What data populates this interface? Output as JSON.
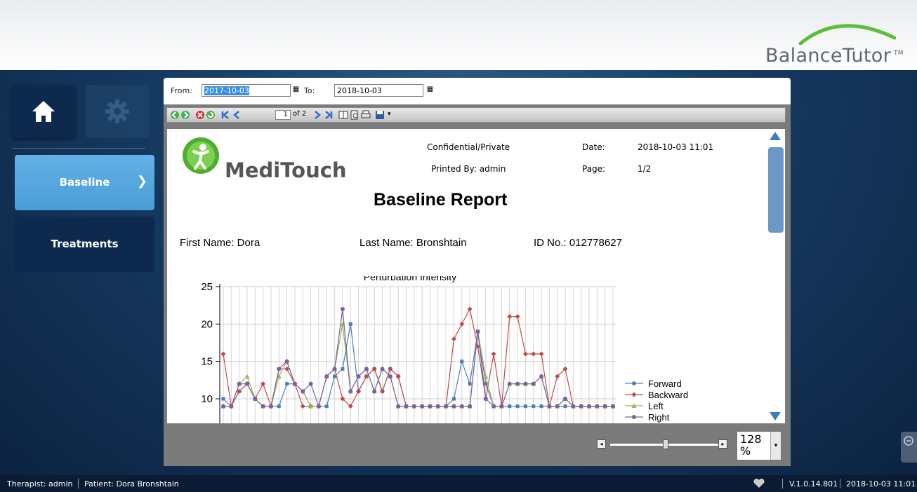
{
  "app": {
    "brand": "BalanceTutor",
    "brand_tm": "TM",
    "accent_green": "#5cbf3a",
    "accent_blue": "#4a9dd6"
  },
  "sidebar": {
    "home_icon": "home-icon",
    "settings_icon": "gear-icon",
    "items": [
      {
        "label": "Baseline",
        "active": true
      },
      {
        "label": "Treatments",
        "active": false
      }
    ]
  },
  "date_range": {
    "from_label": "From:",
    "from_value": "2017-10-03",
    "to_label": "To:",
    "to_value": "2018-10-03"
  },
  "viewer": {
    "page_current": "1",
    "page_total": "of 2",
    "zoom_value": "128",
    "zoom_unit": "%"
  },
  "report": {
    "logo_text": "MediTouch",
    "confidential": "Confidential/Private",
    "printed_by": "Printed By: admin",
    "date_label": "Date:",
    "date_value": "2018-10-03 11:01",
    "page_label": "Page:",
    "page_value": "1/2",
    "title": "Baseline Report",
    "first_name": "First Name:  Dora",
    "last_name": "Last Name:  Bronshtain",
    "id_no": "ID No.: 012778627"
  },
  "chart_data": {
    "type": "line",
    "title": "Perturbation Intensity",
    "xlabel": "",
    "ylabel": "",
    "ylim": [
      9,
      25
    ],
    "yticks": [
      10,
      15,
      20,
      25
    ],
    "grid": true,
    "legend_position": "right",
    "x": [
      1,
      2,
      3,
      4,
      5,
      6,
      7,
      8,
      9,
      10,
      11,
      12,
      13,
      14,
      15,
      16,
      17,
      18,
      19,
      20,
      21,
      22,
      23,
      24,
      25,
      26,
      27,
      28,
      29,
      30,
      31,
      32,
      33,
      34,
      35,
      36,
      37,
      38,
      39,
      40,
      41,
      42,
      43,
      44,
      45,
      46,
      47,
      48,
      49,
      50
    ],
    "series": [
      {
        "name": "Forward",
        "color": "#4a7ebb",
        "marker": "square",
        "values": [
          10,
          9,
          11,
          12,
          10,
          9,
          9,
          9,
          12,
          12,
          11,
          9,
          9,
          9,
          13,
          14,
          20,
          11,
          13,
          14,
          11,
          14,
          13,
          9,
          9,
          9,
          9,
          9,
          9,
          10,
          15,
          12,
          19,
          12,
          9,
          9,
          9,
          9,
          9,
          9,
          9,
          9,
          9,
          9,
          9,
          9,
          9,
          9,
          9,
          9
        ]
      },
      {
        "name": "Backward",
        "color": "#be4b48",
        "marker": "diamond",
        "values": [
          16,
          9,
          11,
          12,
          10,
          12,
          9,
          14,
          14,
          12,
          9,
          9,
          9,
          13,
          14,
          10,
          9,
          11,
          13,
          14,
          11,
          14,
          13,
          9,
          9,
          9,
          9,
          9,
          9,
          18,
          20,
          22,
          17,
          10,
          16,
          9,
          21,
          21,
          16,
          16,
          16,
          9,
          13,
          14,
          9,
          9,
          9,
          9,
          9,
          9
        ]
      },
      {
        "name": "Left",
        "color": "#98b954",
        "marker": "triangle",
        "values": [
          9,
          9,
          12,
          13,
          10,
          9,
          9,
          13,
          15,
          12,
          11,
          9,
          9,
          13,
          14,
          20,
          11,
          13,
          14,
          11,
          14,
          13,
          9,
          9,
          9,
          9,
          9,
          9,
          9,
          9,
          9,
          9,
          19,
          13,
          9,
          9,
          12,
          12,
          12,
          12,
          13,
          9,
          9,
          10,
          9,
          9,
          9,
          9,
          9,
          9
        ]
      },
      {
        "name": "Right",
        "color": "#7d60a0",
        "marker": "circle",
        "values": [
          9,
          9,
          12,
          12,
          10,
          9,
          9,
          14,
          15,
          12,
          11,
          12,
          9,
          13,
          14,
          22,
          11,
          13,
          14,
          11,
          14,
          13,
          9,
          9,
          9,
          9,
          9,
          9,
          9,
          9,
          9,
          9,
          19,
          10,
          9,
          9,
          12,
          12,
          12,
          12,
          13,
          9,
          9,
          10,
          9,
          9,
          9,
          9,
          9,
          9
        ]
      }
    ]
  },
  "status": {
    "therapist": "Therapist: admin",
    "patient": "Patient: Dora Bronshtain",
    "version": "V.1.0.14.801",
    "datetime": "2018-10-03 11:01"
  }
}
